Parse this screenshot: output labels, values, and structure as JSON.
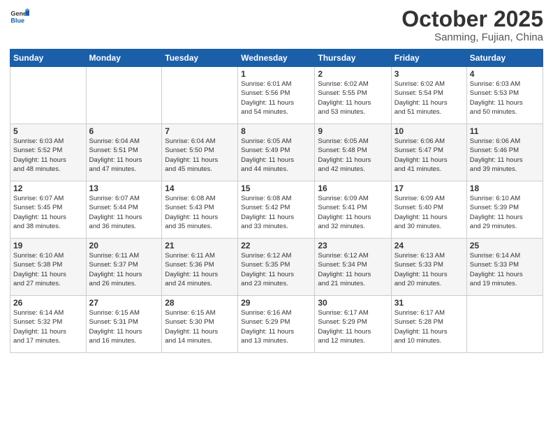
{
  "header": {
    "logo_general": "General",
    "logo_blue": "Blue",
    "month": "October 2025",
    "location": "Sanming, Fujian, China"
  },
  "weekdays": [
    "Sunday",
    "Monday",
    "Tuesday",
    "Wednesday",
    "Thursday",
    "Friday",
    "Saturday"
  ],
  "weeks": [
    [
      {
        "day": "",
        "info": ""
      },
      {
        "day": "",
        "info": ""
      },
      {
        "day": "",
        "info": ""
      },
      {
        "day": "1",
        "info": "Sunrise: 6:01 AM\nSunset: 5:56 PM\nDaylight: 11 hours\nand 54 minutes."
      },
      {
        "day": "2",
        "info": "Sunrise: 6:02 AM\nSunset: 5:55 PM\nDaylight: 11 hours\nand 53 minutes."
      },
      {
        "day": "3",
        "info": "Sunrise: 6:02 AM\nSunset: 5:54 PM\nDaylight: 11 hours\nand 51 minutes."
      },
      {
        "day": "4",
        "info": "Sunrise: 6:03 AM\nSunset: 5:53 PM\nDaylight: 11 hours\nand 50 minutes."
      }
    ],
    [
      {
        "day": "5",
        "info": "Sunrise: 6:03 AM\nSunset: 5:52 PM\nDaylight: 11 hours\nand 48 minutes."
      },
      {
        "day": "6",
        "info": "Sunrise: 6:04 AM\nSunset: 5:51 PM\nDaylight: 11 hours\nand 47 minutes."
      },
      {
        "day": "7",
        "info": "Sunrise: 6:04 AM\nSunset: 5:50 PM\nDaylight: 11 hours\nand 45 minutes."
      },
      {
        "day": "8",
        "info": "Sunrise: 6:05 AM\nSunset: 5:49 PM\nDaylight: 11 hours\nand 44 minutes."
      },
      {
        "day": "9",
        "info": "Sunrise: 6:05 AM\nSunset: 5:48 PM\nDaylight: 11 hours\nand 42 minutes."
      },
      {
        "day": "10",
        "info": "Sunrise: 6:06 AM\nSunset: 5:47 PM\nDaylight: 11 hours\nand 41 minutes."
      },
      {
        "day": "11",
        "info": "Sunrise: 6:06 AM\nSunset: 5:46 PM\nDaylight: 11 hours\nand 39 minutes."
      }
    ],
    [
      {
        "day": "12",
        "info": "Sunrise: 6:07 AM\nSunset: 5:45 PM\nDaylight: 11 hours\nand 38 minutes."
      },
      {
        "day": "13",
        "info": "Sunrise: 6:07 AM\nSunset: 5:44 PM\nDaylight: 11 hours\nand 36 minutes."
      },
      {
        "day": "14",
        "info": "Sunrise: 6:08 AM\nSunset: 5:43 PM\nDaylight: 11 hours\nand 35 minutes."
      },
      {
        "day": "15",
        "info": "Sunrise: 6:08 AM\nSunset: 5:42 PM\nDaylight: 11 hours\nand 33 minutes."
      },
      {
        "day": "16",
        "info": "Sunrise: 6:09 AM\nSunset: 5:41 PM\nDaylight: 11 hours\nand 32 minutes."
      },
      {
        "day": "17",
        "info": "Sunrise: 6:09 AM\nSunset: 5:40 PM\nDaylight: 11 hours\nand 30 minutes."
      },
      {
        "day": "18",
        "info": "Sunrise: 6:10 AM\nSunset: 5:39 PM\nDaylight: 11 hours\nand 29 minutes."
      }
    ],
    [
      {
        "day": "19",
        "info": "Sunrise: 6:10 AM\nSunset: 5:38 PM\nDaylight: 11 hours\nand 27 minutes."
      },
      {
        "day": "20",
        "info": "Sunrise: 6:11 AM\nSunset: 5:37 PM\nDaylight: 11 hours\nand 26 minutes."
      },
      {
        "day": "21",
        "info": "Sunrise: 6:11 AM\nSunset: 5:36 PM\nDaylight: 11 hours\nand 24 minutes."
      },
      {
        "day": "22",
        "info": "Sunrise: 6:12 AM\nSunset: 5:35 PM\nDaylight: 11 hours\nand 23 minutes."
      },
      {
        "day": "23",
        "info": "Sunrise: 6:12 AM\nSunset: 5:34 PM\nDaylight: 11 hours\nand 21 minutes."
      },
      {
        "day": "24",
        "info": "Sunrise: 6:13 AM\nSunset: 5:33 PM\nDaylight: 11 hours\nand 20 minutes."
      },
      {
        "day": "25",
        "info": "Sunrise: 6:14 AM\nSunset: 5:33 PM\nDaylight: 11 hours\nand 19 minutes."
      }
    ],
    [
      {
        "day": "26",
        "info": "Sunrise: 6:14 AM\nSunset: 5:32 PM\nDaylight: 11 hours\nand 17 minutes."
      },
      {
        "day": "27",
        "info": "Sunrise: 6:15 AM\nSunset: 5:31 PM\nDaylight: 11 hours\nand 16 minutes."
      },
      {
        "day": "28",
        "info": "Sunrise: 6:15 AM\nSunset: 5:30 PM\nDaylight: 11 hours\nand 14 minutes."
      },
      {
        "day": "29",
        "info": "Sunrise: 6:16 AM\nSunset: 5:29 PM\nDaylight: 11 hours\nand 13 minutes."
      },
      {
        "day": "30",
        "info": "Sunrise: 6:17 AM\nSunset: 5:29 PM\nDaylight: 11 hours\nand 12 minutes."
      },
      {
        "day": "31",
        "info": "Sunrise: 6:17 AM\nSunset: 5:28 PM\nDaylight: 11 hours\nand 10 minutes."
      },
      {
        "day": "",
        "info": ""
      }
    ]
  ]
}
